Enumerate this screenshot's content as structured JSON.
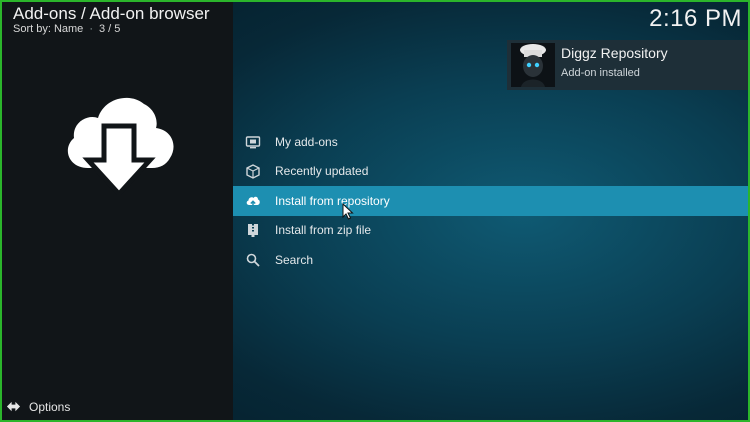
{
  "header": {
    "title": "Add-ons / Add-on browser",
    "sort_label": "Sort by: Name",
    "position": "3 / 5",
    "clock": "2:16 PM"
  },
  "hero": {
    "icon": "cloud-download-icon"
  },
  "notification": {
    "title": "Diggz Repository",
    "message": "Add-on installed",
    "icon": "chef-avatar-icon"
  },
  "menu": {
    "items": [
      {
        "label": "My add-ons",
        "icon": "monitor-box-icon",
        "active": false
      },
      {
        "label": "Recently updated",
        "icon": "package-icon",
        "active": false
      },
      {
        "label": "Install from repository",
        "icon": "cloud-upload-icon",
        "active": true
      },
      {
        "label": "Install from zip file",
        "icon": "zip-file-icon",
        "active": false
      },
      {
        "label": "Search",
        "icon": "search-icon",
        "active": false
      }
    ]
  },
  "footer": {
    "options_label": "Options",
    "icon": "options-arrows-icon"
  },
  "colors": {
    "background": "#0a3e52",
    "left_panel": "#111518",
    "highlight": "#1d8fb1",
    "text": "#f2f2f2",
    "frame": "#2bb52b"
  }
}
